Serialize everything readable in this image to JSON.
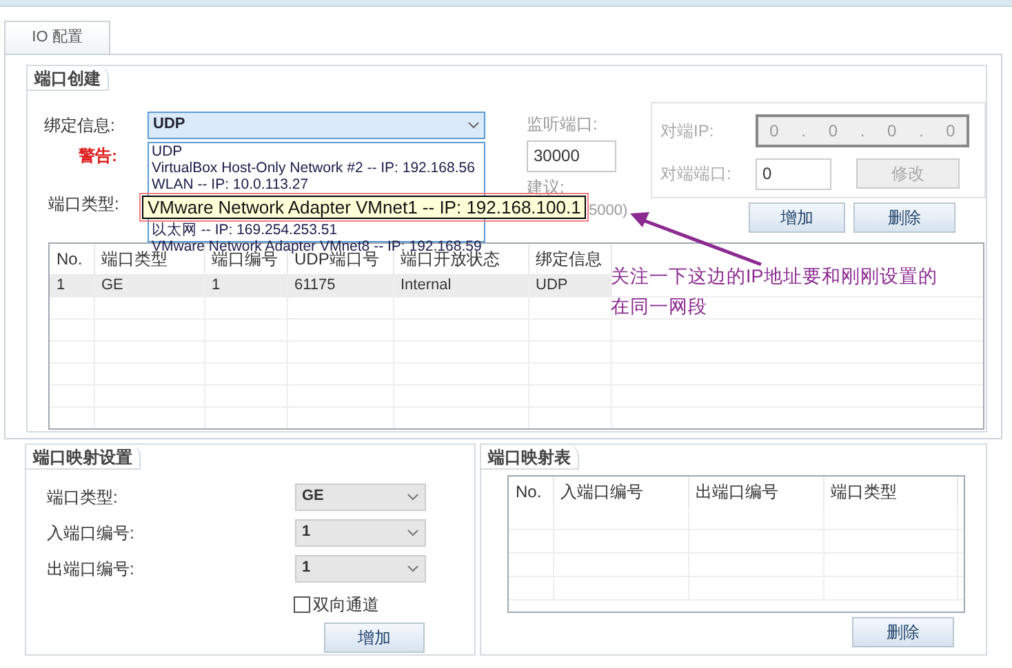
{
  "tabs": [
    {
      "label": "IO 配置",
      "selected": true
    }
  ],
  "port_creation": {
    "title": "端口创建",
    "bind_label": "绑定信息:",
    "bind_value": "UDP",
    "warning_label": "警告:",
    "port_type_label": "端口类型:",
    "dropdown_options": [
      {
        "label": "UDP",
        "selected": false
      },
      {
        "label": "VirtualBox Host-Only Network #2 -- IP: 192.168.56",
        "selected": false
      },
      {
        "label": "WLAN -- IP: 10.0.113.27",
        "selected": false
      },
      {
        "label": "VMware Network Adapter VMnet1 -- IP: 192.168.100.1",
        "selected": true
      },
      {
        "label": "以太网 -- IP: 169.254.253.51",
        "selected": false
      },
      {
        "label": "VMware Network Adapter VMnet8 -- IP: 192.168.59",
        "selected": false
      }
    ],
    "listen_port_label": "监听端口:",
    "listen_port_value": "30000",
    "suggest_label": "建议:",
    "suggest_hint": "5000)",
    "peer_ip_label": "对端IP:",
    "peer_ip": [
      "0",
      "0",
      "0",
      "0"
    ],
    "peer_ip_separator": ".",
    "peer_port_label": "对端端口:",
    "peer_port_value": "0",
    "modify_button": "修改",
    "add_button": "增加",
    "delete_button": "删除",
    "table": {
      "columns": [
        "No.",
        "端口类型",
        "端口编号",
        "UDP端口号",
        "端口开放状态",
        "绑定信息"
      ],
      "rows": [
        [
          "1",
          "GE",
          "1",
          "61175",
          "Internal",
          "UDP"
        ]
      ]
    }
  },
  "port_mapping_settings": {
    "title": "端口映射设置",
    "fields": [
      {
        "label": "端口类型:",
        "value": "GE"
      },
      {
        "label": "入端口编号:",
        "value": "1"
      },
      {
        "label": "出端口编号:",
        "value": "1"
      }
    ],
    "bidirectional": {
      "label": "双向通道",
      "checked": false
    },
    "add_button": "增加"
  },
  "port_mapping_table": {
    "title": "端口映射表",
    "columns": [
      "No.",
      "入端口编号",
      "出端口编号",
      "端口类型"
    ],
    "delete_button": "删除"
  },
  "annotation": {
    "text": "关注一下这边的IP地址要和刚刚设置的在同一网段"
  }
}
